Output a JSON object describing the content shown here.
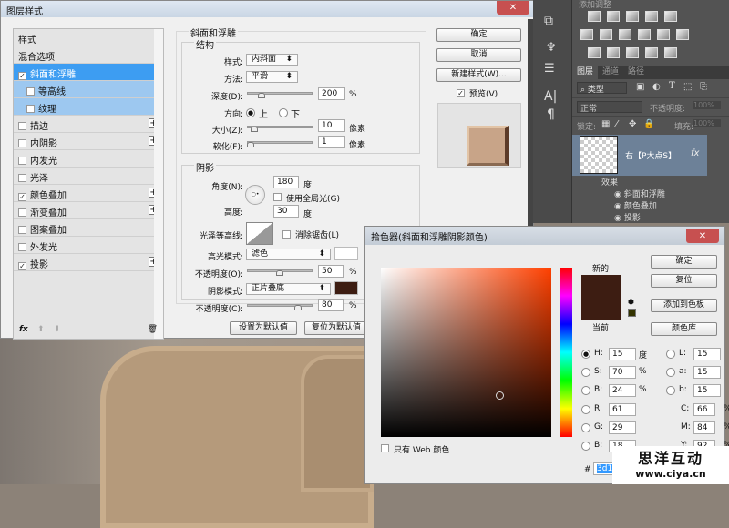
{
  "layer_style": {
    "title": "图层样式",
    "close": "✕",
    "styles_header": "样式",
    "blending_options": "混合选项",
    "items": [
      {
        "label": "斜面和浮雕",
        "checked": true,
        "selected": true
      },
      {
        "label": "等高线",
        "checked": false,
        "sub": true
      },
      {
        "label": "纹理",
        "checked": false,
        "sub": true
      },
      {
        "label": "描边",
        "checked": false,
        "plus": true
      },
      {
        "label": "内阴影",
        "checked": false,
        "plus": true
      },
      {
        "label": "内发光",
        "checked": false
      },
      {
        "label": "光泽",
        "checked": false
      },
      {
        "label": "颜色叠加",
        "checked": true,
        "plus": true
      },
      {
        "label": "渐变叠加",
        "checked": false,
        "plus": true
      },
      {
        "label": "图案叠加",
        "checked": false
      },
      {
        "label": "外发光",
        "checked": false
      },
      {
        "label": "投影",
        "checked": true,
        "plus": true
      }
    ],
    "fx_label": "fx",
    "bevel": {
      "section": "斜面和浮雕",
      "structure": "结构",
      "style_label": "样式:",
      "style_value": "内斜面",
      "method_label": "方法:",
      "method_value": "平滑",
      "depth_label": "深度(D):",
      "depth_value": "200",
      "depth_unit": "%",
      "direction_label": "方向:",
      "dir_up": "上",
      "dir_down": "下",
      "direction_selected": "上",
      "size_label": "大小(Z):",
      "size_value": "10",
      "size_unit": "像素",
      "soften_label": "软化(F):",
      "soften_value": "1",
      "soften_unit": "像素"
    },
    "shading": {
      "section": "阴影",
      "angle_label": "角度(N):",
      "angle_value": "180",
      "angle_unit": "度",
      "global_light": "使用全局光(G)",
      "global_light_checked": false,
      "altitude_label": "高度:",
      "altitude_value": "30",
      "altitude_unit": "度",
      "gloss_label": "光泽等高线:",
      "antialias": "消除锯齿(L)",
      "antialias_checked": false,
      "highlight_label": "高光模式:",
      "highlight_value": "滤色",
      "highlight_color": "#ffffff",
      "hl_opacity_label": "不透明度(O):",
      "hl_opacity_value": "50",
      "hl_opacity_unit": "%",
      "shadow_label": "阴影模式:",
      "shadow_value": "正片叠底",
      "shadow_color": "#3d1d12",
      "sh_opacity_label": "不透明度(C):",
      "sh_opacity_value": "80",
      "sh_opacity_unit": "%"
    },
    "make_default": "设置为默认值",
    "reset_default": "复位为默认值",
    "ok": "确定",
    "cancel": "取消",
    "new_style": "新建样式(W)...",
    "preview": "预览(V)",
    "preview_checked": true
  },
  "panels": {
    "adjustments_title": "添加调整",
    "tabs": [
      "图层",
      "通道",
      "路径"
    ],
    "filter_kind": "类型",
    "blend_mode": "正常",
    "opacity_label": "不透明度:",
    "opacity_value": "100%",
    "lock_label": "锁定:",
    "fill_label": "填充:",
    "fill_value": "100%",
    "layer_name": "右【P大点S】",
    "fx": "fx",
    "effects_label": "效果",
    "effects": [
      "斜面和浮雕",
      "颜色叠加",
      "投影"
    ]
  },
  "color_picker": {
    "title": "拾色器(斜面和浮雕阴影颜色)",
    "close": "✕",
    "new_label": "新的",
    "current_label": "当前",
    "new_color": "#3d1d12",
    "current_color": "#3d1d12",
    "ok": "确定",
    "reset": "复位",
    "add_swatch": "添加到色板",
    "libraries": "颜色库",
    "web_only": "只有 Web 颜色",
    "fields": {
      "H": {
        "label": "H:",
        "value": "15",
        "unit": "度",
        "selected": true
      },
      "S": {
        "label": "S:",
        "value": "70",
        "unit": "%"
      },
      "Bv": {
        "label": "B:",
        "value": "24",
        "unit": "%"
      },
      "R": {
        "label": "R:",
        "value": "61"
      },
      "G": {
        "label": "G:",
        "value": "29"
      },
      "Bl": {
        "label": "B:",
        "value": "18"
      },
      "L": {
        "label": "L:",
        "value": "15"
      },
      "a": {
        "label": "a:",
        "value": "15"
      },
      "b": {
        "label": "b:",
        "value": "15"
      },
      "C": {
        "label": "C:",
        "value": "66",
        "unit": "%"
      },
      "M": {
        "label": "M:",
        "value": "84",
        "unit": "%"
      },
      "Y": {
        "label": "Y:",
        "value": "92",
        "unit": "%"
      }
    },
    "hash": "#",
    "hex": "3d1d12"
  },
  "watermark": {
    "line1": "思洋互动",
    "line2": "www.ciya.cn"
  }
}
